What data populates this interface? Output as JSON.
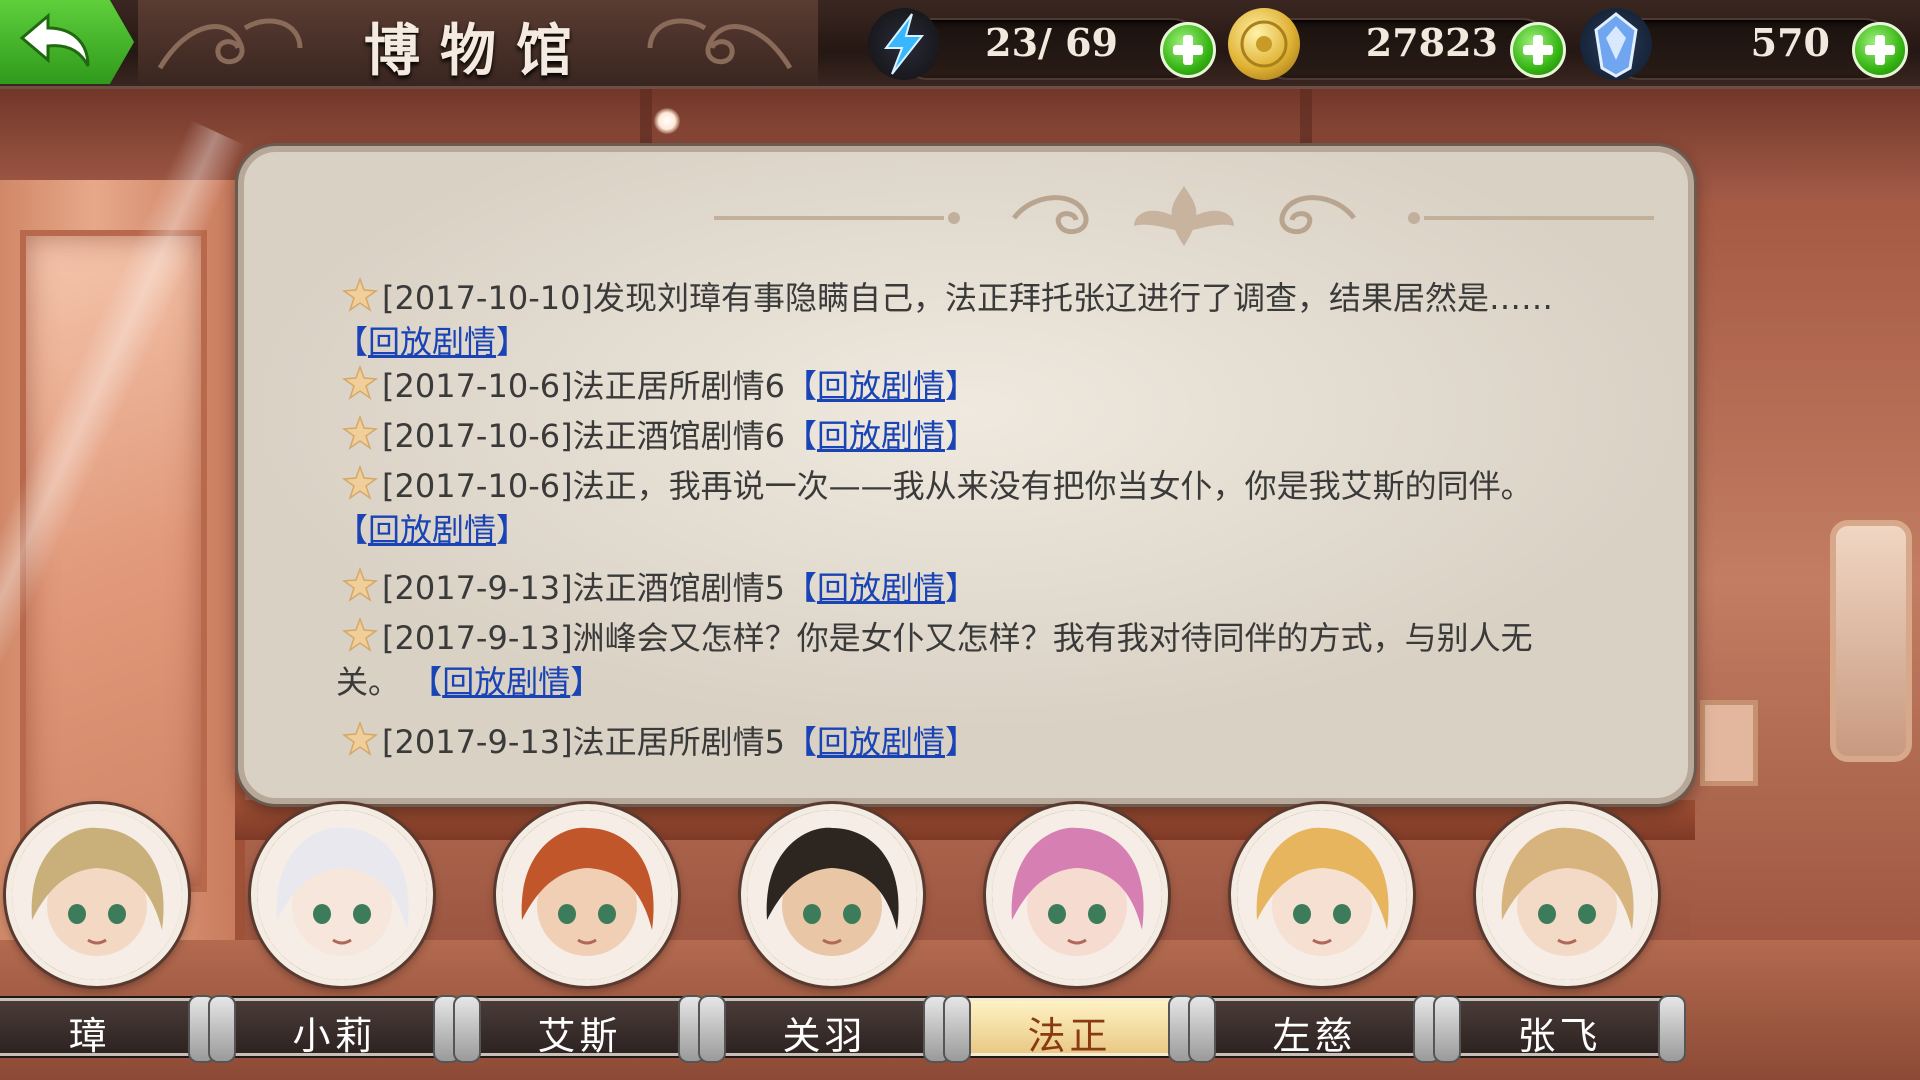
{
  "header": {
    "title": "博物馆",
    "stamina": "23/ 69",
    "gold": "27823",
    "gems": "570"
  },
  "entries": [
    {
      "text": "[2017-10-10]发现刘璋有事隐瞒自己，法正拜托张辽进行了调查，结果居然是……",
      "link": "回放剧情"
    },
    {
      "text": "[2017-10-6]法正居所剧情6",
      "link": "回放剧情"
    },
    {
      "text": "[2017-10-6]法正酒馆剧情6",
      "link": "回放剧情"
    },
    {
      "text": "[2017-10-6]法正，我再说一次——我从来没有把你当女仆，你是我艾斯的同伴。",
      "link": "回放剧情"
    },
    {
      "text": "[2017-9-13]法正酒馆剧情5",
      "link": "回放剧情"
    },
    {
      "text": "[2017-9-13]洲峰会又怎样？你是女仆又怎样？我有我对待同伴的方式，与别人无",
      "text_cont": "关。",
      "link": "回放剧情"
    },
    {
      "text": "[2017-9-13]法正居所剧情5",
      "link": "回放剧情"
    }
  ],
  "characters": [
    {
      "name": "璋",
      "hair": "#c9b07a",
      "skin": "#f3d9c4"
    },
    {
      "name": "小莉",
      "hair": "#e8e8ee",
      "skin": "#f7e6dc"
    },
    {
      "name": "艾斯",
      "hair": "#c0562a",
      "skin": "#f1cfb5"
    },
    {
      "name": "关羽",
      "hair": "#2d2620",
      "skin": "#e9c7a6"
    },
    {
      "name": "法正",
      "hair": "#d67fb3",
      "skin": "#f6dcd0",
      "selected": true
    },
    {
      "name": "左慈",
      "hair": "#e6b55e",
      "skin": "#f6e0d2"
    },
    {
      "name": "张飞",
      "hair": "#d7b47e",
      "skin": "#f3dac6"
    }
  ],
  "icons": [
    "back-arrow-icon",
    "lightning-icon",
    "gold-coin-icon",
    "crystal-gem-icon",
    "plus-icon",
    "star-icon"
  ]
}
